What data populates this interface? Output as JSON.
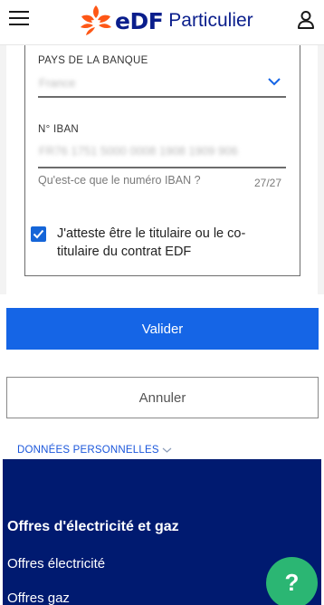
{
  "header": {
    "logo_text": "eDF",
    "logo_subtitle": "Particulier",
    "menu_icon": "hamburger-menu-icon",
    "account_icon": "user-account-icon"
  },
  "form": {
    "bank_country": {
      "label": "PAYS DE LA BANQUE",
      "value": "France"
    },
    "iban": {
      "label": "N° IBAN",
      "value": "FR76 1751 5000 0008 1908 1909 906",
      "help_link": "Qu'est-ce que le numéro IBAN ?",
      "char_count": "27/27"
    },
    "attestation": {
      "checked": true,
      "label": "J'atteste être le titulaire ou le co-titulaire du contrat EDF"
    }
  },
  "actions": {
    "validate_label": "Valider",
    "cancel_label": "Annuler"
  },
  "personal_data_link": "DONNÉES PERSONNELLES",
  "footer": {
    "section_title": "Offres d'électricité et gaz",
    "links": [
      "Offres électricité",
      "Offres gaz"
    ],
    "help_label": "?"
  },
  "colors": {
    "brand_blue": "#0a1e8c",
    "brand_orange": "#fe5716",
    "primary_button": "#1565e6",
    "footer_bg": "#001a70",
    "help_fab": "#2bb673"
  }
}
